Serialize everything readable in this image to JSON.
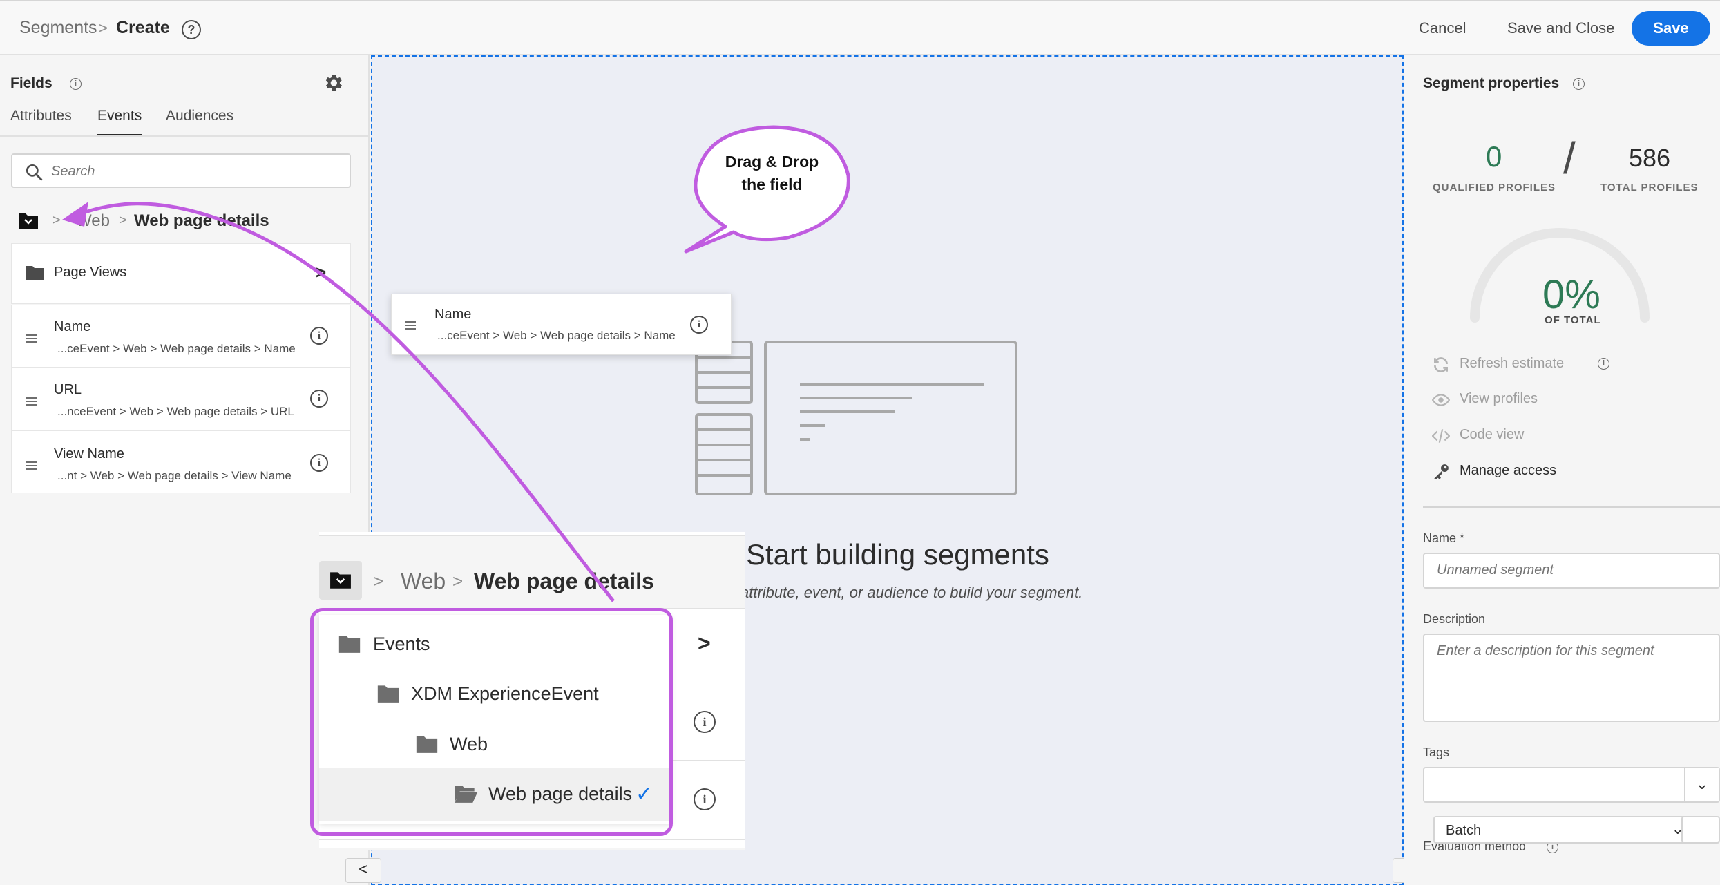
{
  "header": {
    "breadcrumb_segments": "Segments",
    "breadcrumb_separator": ">",
    "breadcrumb_create": "Create",
    "help_glyph": "?",
    "cancel_label": "Cancel",
    "save_close_label": "Save and Close",
    "save_label": "Save"
  },
  "fields_panel": {
    "title": "Fields",
    "tabs": [
      "Attributes",
      "Events",
      "Audiences"
    ],
    "active_tab": "Events",
    "search_placeholder": "Search",
    "path": {
      "parent": "Web",
      "current": "Web page details"
    },
    "folder_item": "Page Views",
    "items": [
      {
        "name": "Name",
        "path": "...ceEvent > Web > Web page details > Name"
      },
      {
        "name": "URL",
        "path": "...nceEvent > Web > Web page details > URL"
      },
      {
        "name": "View Name",
        "path": "...nt > Web > Web page details > View Name"
      }
    ]
  },
  "canvas": {
    "callout": "Drag & Drop the field",
    "callout_line1": "Drag & Drop",
    "callout_line2": "the field",
    "dragged_field": {
      "name": "Name",
      "path": "...ceEvent > Web > Web page details > Name"
    },
    "empty_title": "Start building segments",
    "empty_subtitle": "attribute, event, or audience to build your segment.",
    "zoom": {
      "path_parent": "Web",
      "path_current": "Web page details",
      "menu_items": [
        "Events",
        "XDM ExperienceEvent",
        "Web",
        "Web page details"
      ],
      "selected_item": "Web page details"
    },
    "annotation_color": "#c05ce0"
  },
  "properties": {
    "title": "Segment properties",
    "qualified_count": "0",
    "qualified_label": "QUALIFIED PROFILES",
    "total_count": "586",
    "total_label": "TOTAL PROFILES",
    "percent": "0%",
    "percent_label": "OF TOTAL",
    "actions": [
      "Refresh estimate",
      "View profiles",
      "Code view",
      "Manage access"
    ],
    "name_label": "Name *",
    "name_placeholder": "Unnamed segment",
    "description_label": "Description",
    "description_placeholder": "Enter a description for this segment",
    "tags_label": "Tags",
    "evaluation_label": "Evaluation method",
    "evaluation_value": "Batch"
  },
  "colors": {
    "accent": "#1473e6",
    "positive": "#2d7a55"
  },
  "icons": {
    "info": "i",
    "chevron_right": ">",
    "chevron_down": "⌄",
    "check": "✓",
    "nav_left": "<",
    "nav_right": ">"
  }
}
